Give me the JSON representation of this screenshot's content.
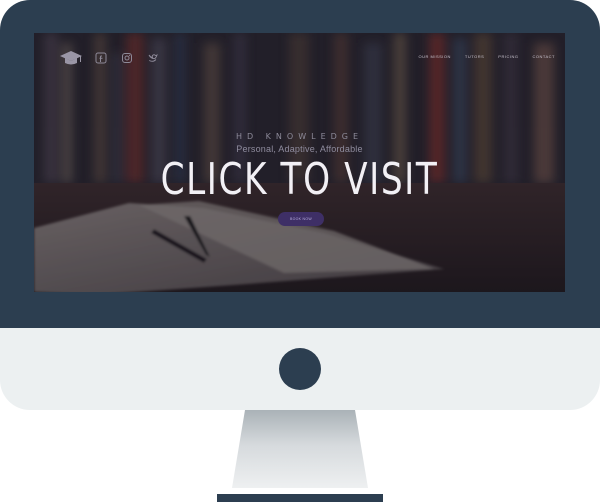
{
  "site": {
    "brand": "HD KNOWLEDGE",
    "tagline": "Personal, Adaptive, Affordable",
    "headline": "CLICK TO VISIT",
    "cta_label": "BOOK NOW",
    "nav": [
      "Our Mission",
      "Tutors",
      "Pricing",
      "Contact"
    ],
    "social_icons": [
      "facebook-icon",
      "instagram-icon",
      "twitter-icon"
    ],
    "logo_icon": "graduation-cap-icon"
  },
  "colors": {
    "bezel": "#2c3e50",
    "chin": "#ecf0f1",
    "cta": "#3e2f66",
    "headline": "#f2f0f5"
  }
}
